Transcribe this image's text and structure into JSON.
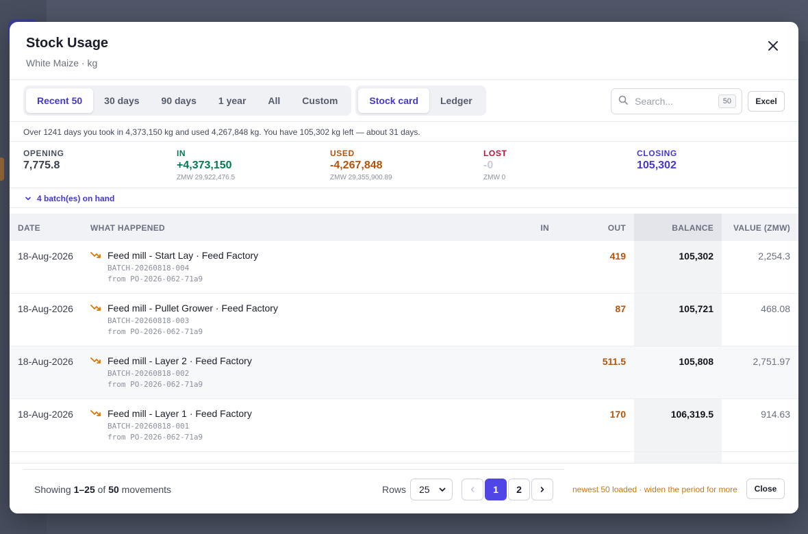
{
  "modal": {
    "title": "Stock Usage",
    "subtitle": "White Maize · kg"
  },
  "period_tabs": [
    {
      "label": "Recent 50",
      "active": true
    },
    {
      "label": "30 days",
      "active": false
    },
    {
      "label": "90 days",
      "active": false
    },
    {
      "label": "1 year",
      "active": false
    },
    {
      "label": "All",
      "active": false
    },
    {
      "label": "Custom",
      "active": false
    }
  ],
  "view_tabs": [
    {
      "label": "Stock card",
      "active": true
    },
    {
      "label": "Ledger",
      "active": false
    }
  ],
  "search": {
    "placeholder": "Search...",
    "badge": "50"
  },
  "excel_label": "Excel",
  "summary_text": "Over 1241 days you took in 4,373,150 kg and used 4,267,848 kg. You have 105,302 kg left — about 31 days.",
  "stats": {
    "opening": {
      "label": "OPENING",
      "value": "7,775.8",
      "sub": "",
      "color": "#3a3f4d"
    },
    "in": {
      "label": "IN",
      "value": "+4,373,150",
      "sub": "ZMW 29,922,476.5",
      "color": "#047857"
    },
    "used": {
      "label": "USED",
      "value": "-4,267,848",
      "sub": "ZMW 29,355,900.89",
      "color": "#b45309"
    },
    "lost": {
      "label": "LOST",
      "value": "-0",
      "sub": "ZMW 0",
      "color": "#be123c"
    },
    "closing": {
      "label": "CLOSING",
      "value": "105,302",
      "sub": "",
      "color": "#4338ca"
    }
  },
  "batches_label": "4 batch(es) on hand",
  "table": {
    "headers": {
      "date": "DATE",
      "what": "WHAT HAPPENED",
      "in": "IN",
      "out": "OUT",
      "balance": "BALANCE",
      "value": "VALUE (ZMW)"
    },
    "rows": [
      {
        "date": "18-Aug-2026",
        "what": "Feed mill - Start Lay · Feed Factory",
        "batch": "BATCH-20260818-004",
        "from": "from PO-2026-062-71a9",
        "in": "",
        "out": "419",
        "balance": "105,302",
        "value": "2,254.3"
      },
      {
        "date": "18-Aug-2026",
        "what": "Feed mill - Pullet Grower · Feed Factory",
        "batch": "BATCH-20260818-003",
        "from": "from PO-2026-062-71a9",
        "in": "",
        "out": "87",
        "balance": "105,721",
        "value": "468.08"
      },
      {
        "date": "18-Aug-2026",
        "what": "Feed mill - Layer 2 · Feed Factory",
        "batch": "BATCH-20260818-002",
        "from": "from PO-2026-062-71a9",
        "in": "",
        "out": "511.5",
        "balance": "105,808",
        "value": "2,751.97"
      },
      {
        "date": "18-Aug-2026",
        "what": "Feed mill - Layer 1 · Feed Factory",
        "batch": "BATCH-20260818-001",
        "from": "from PO-2026-062-71a9",
        "in": "",
        "out": "170",
        "balance": "106,319.5",
        "value": "914.63"
      }
    ]
  },
  "footer": {
    "showing_prefix": "Showing ",
    "showing_range": "1–25",
    "showing_of": " of ",
    "showing_total": "50",
    "showing_suffix": " movements",
    "rows_label": "Rows",
    "rows_value": "25",
    "pages": [
      "1",
      "2"
    ],
    "current_page": "1",
    "note": "newest 50 loaded · widen the period for more",
    "close_label": "Close"
  },
  "icons": {
    "close": "close-icon",
    "search": "search-icon",
    "chevron": "chevron-down-icon",
    "trend": "trend-down-icon",
    "prev": "chevron-left-icon",
    "next": "chevron-right-icon"
  }
}
